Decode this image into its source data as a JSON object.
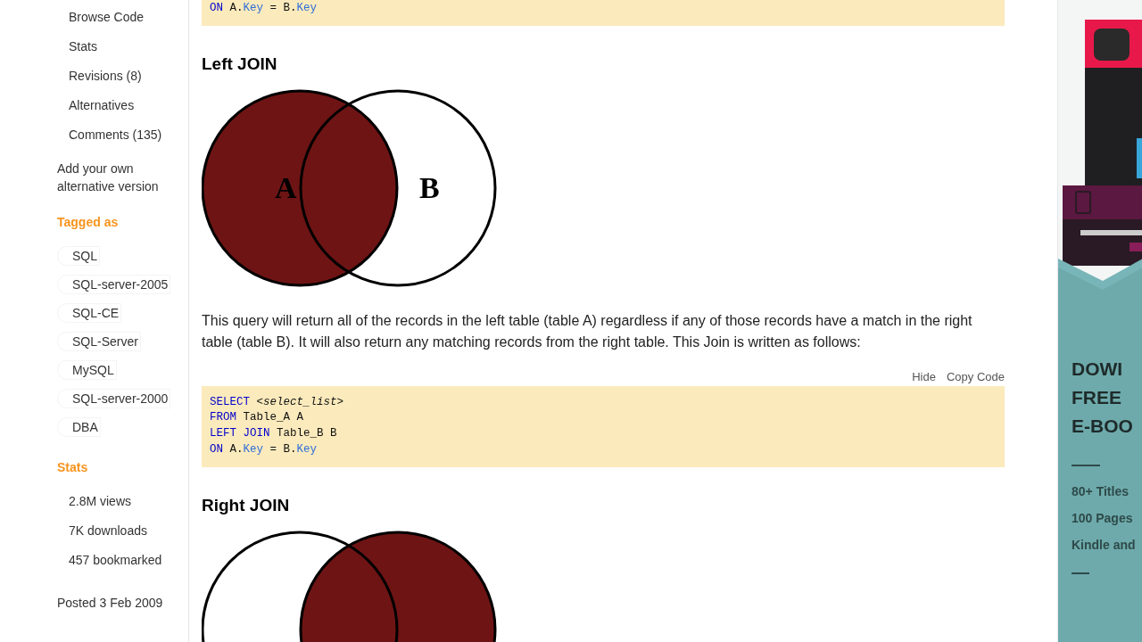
{
  "sidebar": {
    "links": [
      "Browse Code",
      "Stats",
      "Revisions (8)",
      "Alternatives",
      "Comments (135)"
    ],
    "add_link": "Add your own alternative version",
    "tagged_heading": "Tagged as",
    "tags": [
      "SQL",
      "SQL-server-2005",
      "SQL-CE",
      "SQL-Server",
      "MySQL",
      "SQL-server-2000",
      "DBA"
    ],
    "stats_heading": "Stats",
    "stats": [
      "2.8M views",
      "7K downloads",
      "457 bookmarked"
    ],
    "posted": "Posted 3 Feb 2009"
  },
  "article": [
    {
      "kind": "code",
      "lines": [
        [
          {
            "kind": "keyword",
            "text": "ON"
          },
          {
            "kind": "plain",
            "text": " A."
          },
          {
            "kind": "member",
            "text": "Key"
          },
          {
            "kind": "plain",
            "text": " = B."
          },
          {
            "kind": "member",
            "text": "Key"
          }
        ]
      ]
    },
    {
      "kind": "heading",
      "text": "Left JOIN"
    },
    {
      "kind": "venn",
      "left_filled": true,
      "right_filled": false,
      "label_a": "A",
      "label_b": "B"
    },
    {
      "kind": "paragraph",
      "text": "This query will return all of the records in the left table (table A) regardless if any of those records have a match in the right table (table B). It will also return any matching records from the right table. This Join is written as follows:"
    },
    {
      "kind": "code",
      "actions": [
        "Hide",
        "Copy Code"
      ],
      "lines": [
        [
          {
            "kind": "keyword",
            "text": "SELECT"
          },
          {
            "kind": "italic",
            "text": " <select_list>"
          }
        ],
        [
          {
            "kind": "keyword",
            "text": "FROM"
          },
          {
            "kind": "plain",
            "text": " Table_A A"
          }
        ],
        [
          {
            "kind": "keyword",
            "text": "LEFT JOIN"
          },
          {
            "kind": "plain",
            "text": " Table_B B"
          }
        ],
        [
          {
            "kind": "keyword",
            "text": "ON"
          },
          {
            "kind": "plain",
            "text": " A."
          },
          {
            "kind": "member",
            "text": "Key"
          },
          {
            "kind": "plain",
            "text": " = B."
          },
          {
            "kind": "member",
            "text": "Key"
          }
        ]
      ]
    },
    {
      "kind": "heading",
      "text": "Right JOIN"
    },
    {
      "kind": "venn",
      "left_filled": false,
      "right_filled": true
    }
  ],
  "ad": {
    "headline": [
      "DOWI",
      "FREE",
      "E-BOO"
    ],
    "features": [
      "80+ Titles",
      "100 Pages",
      "Kindle and"
    ]
  }
}
